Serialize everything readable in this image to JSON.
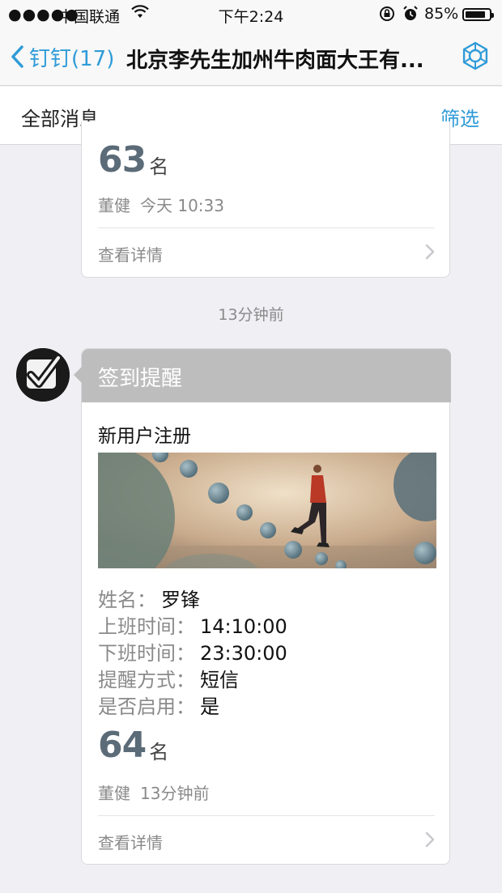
{
  "status": {
    "signal_dots": "●●●●●",
    "carrier": "中国联通",
    "time": "下午2:24",
    "battery_text": "85%",
    "battery_level": 0.85
  },
  "nav": {
    "back_label": "钉钉(17)",
    "title": "北京李先生加州牛肉面大王有..."
  },
  "filterbar": {
    "title": "全部消息",
    "filter_label": "筛选"
  },
  "messages": [
    {
      "rank_number": "63",
      "rank_unit": "名",
      "sender": "董健",
      "time": "今天 10:33",
      "detail_label": "查看详情"
    },
    {
      "header": "签到提醒",
      "subtitle": "新用户注册",
      "fields": [
        {
          "key": "姓名：",
          "value": "罗锋"
        },
        {
          "key": "上班时间：",
          "value": "14:10:00"
        },
        {
          "key": "下班时间：",
          "value": "23:30:00"
        },
        {
          "key": "提醒方式：",
          "value": "短信"
        },
        {
          "key": "是否启用：",
          "value": "是"
        }
      ],
      "rank_number": "64",
      "rank_unit": "名",
      "sender": "董健",
      "time": "13分钟前",
      "detail_label": "查看详情"
    }
  ],
  "time_separator": "13分钟前",
  "colors": {
    "accent": "#2f9bd8",
    "card_header": "#bdbdbd",
    "background": "#efeff4"
  }
}
